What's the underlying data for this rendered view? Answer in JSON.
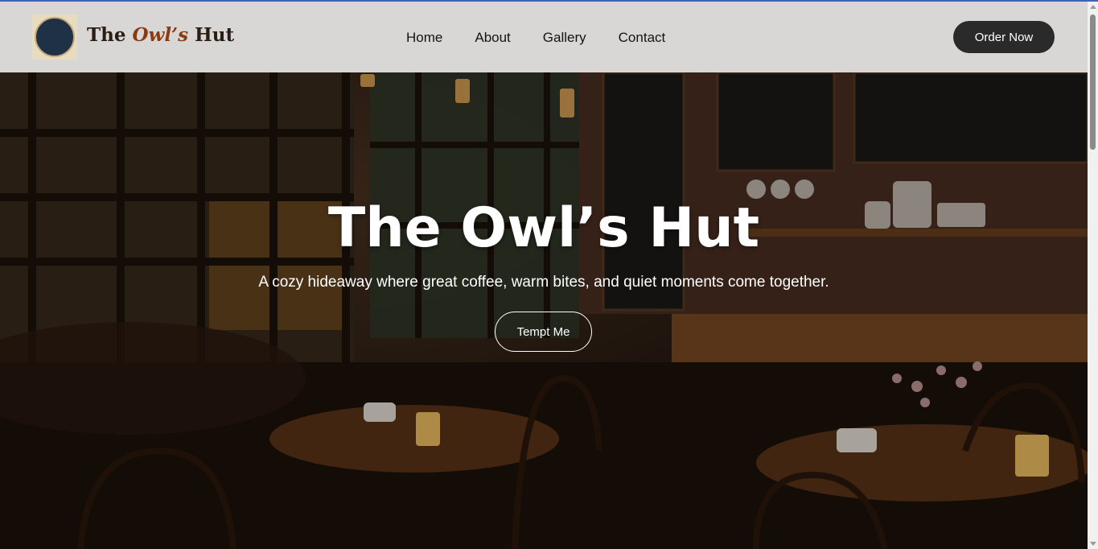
{
  "brand": {
    "name_prefix": "The ",
    "name_accent": "Owl’s",
    "name_suffix": " Hut",
    "logo_icon": "owl-icon"
  },
  "nav": {
    "items": [
      {
        "label": "Home"
      },
      {
        "label": "About"
      },
      {
        "label": "Gallery"
      },
      {
        "label": "Contact"
      }
    ]
  },
  "order_button": {
    "label": "Order Now"
  },
  "hero": {
    "title": "The Owl’s Hut",
    "subtitle": "A cozy hideaway where great coffee, warm bites, and quiet moments come together.",
    "cta_label": "Tempt Me"
  },
  "colors": {
    "brand_accent": "#8b3a12",
    "nav_bg": "#d9d7d5",
    "button_dark": "#2a2a2a",
    "hero_text": "#ffffff"
  }
}
